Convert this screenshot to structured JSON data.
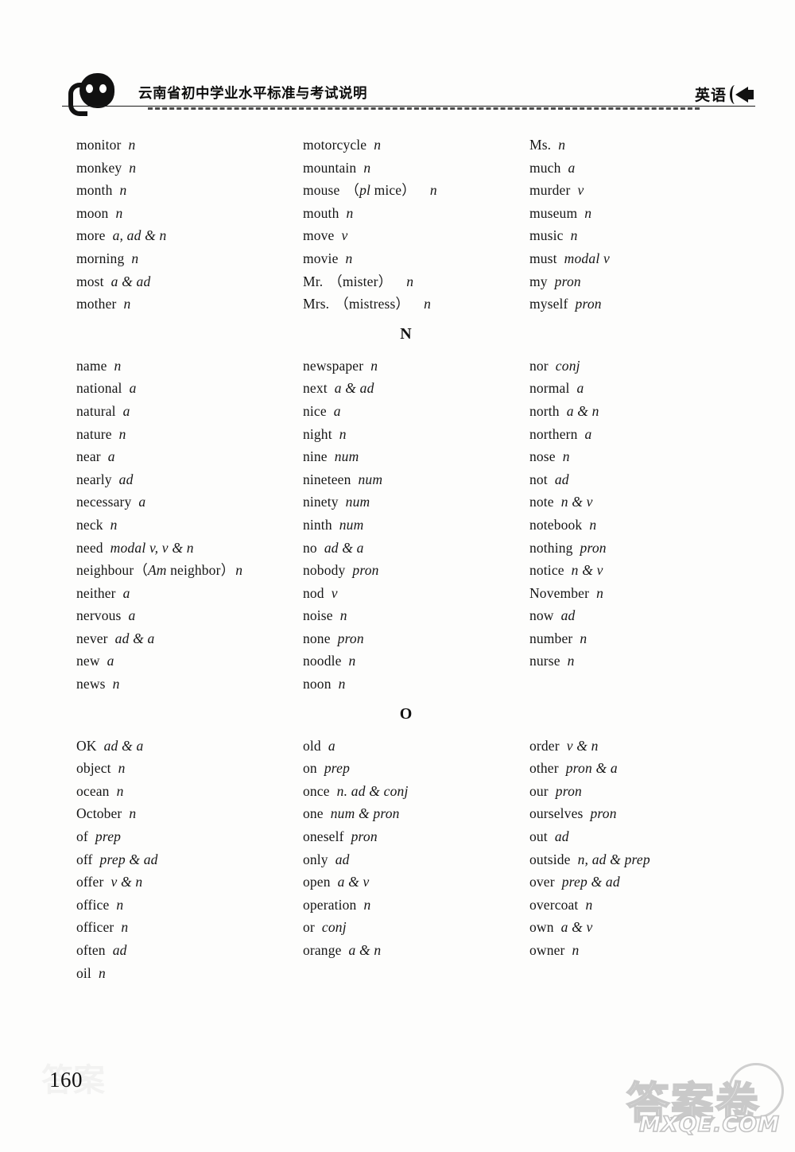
{
  "header": {
    "book_title": "云南省初中学业水平标准与考试说明",
    "subject": "英语",
    "left_icon": "head-silhouette-icon",
    "right_icon": "speaker-icon"
  },
  "page_number": "160",
  "watermark": {
    "chinese": "答案卷",
    "domain": "MXQE.COM"
  },
  "sections": [
    {
      "letter": "",
      "columns": [
        [
          {
            "word": "monitor",
            "pos": "n"
          },
          {
            "word": "monkey",
            "pos": "n"
          },
          {
            "word": "month",
            "pos": "n"
          },
          {
            "word": "moon",
            "pos": "n"
          },
          {
            "word": "more",
            "pos": "a, ad & n"
          },
          {
            "word": "morning",
            "pos": "n"
          },
          {
            "word": "most",
            "pos": "a & ad"
          },
          {
            "word": "mother",
            "pos": "n"
          }
        ],
        [
          {
            "word": "motorcycle",
            "pos": "n"
          },
          {
            "word": "mountain",
            "pos": "n"
          },
          {
            "word": "mouse",
            "paren_italic": "pl",
            "paren_plain": "mice",
            "pos": "n"
          },
          {
            "word": "mouth",
            "pos": "n"
          },
          {
            "word": "move",
            "pos": "v"
          },
          {
            "word": "movie",
            "pos": "n"
          },
          {
            "word": "Mr.",
            "paren_plain": "mister",
            "pos": "n"
          },
          {
            "word": "Mrs.",
            "paren_plain": "mistress",
            "pos": "n"
          }
        ],
        [
          {
            "word": "Ms.",
            "pos": "n"
          },
          {
            "word": "much",
            "pos": "a"
          },
          {
            "word": "murder",
            "pos": "v"
          },
          {
            "word": "museum",
            "pos": "n"
          },
          {
            "word": "music",
            "pos": "n"
          },
          {
            "word": "must",
            "pos": "modal v"
          },
          {
            "word": "my",
            "pos": "pron"
          },
          {
            "word": "myself",
            "pos": "pron"
          }
        ]
      ]
    },
    {
      "letter": "N",
      "columns": [
        [
          {
            "word": "name",
            "pos": "n"
          },
          {
            "word": "national",
            "pos": "a"
          },
          {
            "word": "natural",
            "pos": "a"
          },
          {
            "word": "nature",
            "pos": "n"
          },
          {
            "word": "near",
            "pos": "a"
          },
          {
            "word": "nearly",
            "pos": "ad"
          },
          {
            "word": "necessary",
            "pos": "a"
          },
          {
            "word": "neck",
            "pos": "n"
          },
          {
            "word": "need",
            "pos": "modal v, v & n"
          },
          {
            "word": "neighbour",
            "paren_italic": "Am",
            "paren_plain": "neighbor",
            "pos": "n",
            "tight": true
          },
          {
            "word": "neither",
            "pos": "a"
          },
          {
            "word": "nervous",
            "pos": "a"
          },
          {
            "word": "never",
            "pos": "ad & a"
          },
          {
            "word": "new",
            "pos": "a"
          },
          {
            "word": "news",
            "pos": "n"
          }
        ],
        [
          {
            "word": "newspaper",
            "pos": "n"
          },
          {
            "word": "next",
            "pos": "a & ad"
          },
          {
            "word": "nice",
            "pos": "a"
          },
          {
            "word": "night",
            "pos": "n"
          },
          {
            "word": "nine",
            "pos": "num"
          },
          {
            "word": "nineteen",
            "pos": "num"
          },
          {
            "word": "ninety",
            "pos": "num"
          },
          {
            "word": "ninth",
            "pos": "num"
          },
          {
            "word": "no",
            "pos": "ad & a"
          },
          {
            "word": "nobody",
            "pos": "pron"
          },
          {
            "word": "nod",
            "pos": "v"
          },
          {
            "word": "noise",
            "pos": "n"
          },
          {
            "word": "none",
            "pos": "pron"
          },
          {
            "word": "noodle",
            "pos": "n"
          },
          {
            "word": "noon",
            "pos": "n"
          }
        ],
        [
          {
            "word": "nor",
            "pos": "conj"
          },
          {
            "word": "normal",
            "pos": "a"
          },
          {
            "word": "north",
            "pos": "a & n"
          },
          {
            "word": "northern",
            "pos": "a"
          },
          {
            "word": "nose",
            "pos": "n"
          },
          {
            "word": "not",
            "pos": "ad"
          },
          {
            "word": "note",
            "pos": "n & v"
          },
          {
            "word": "notebook",
            "pos": "n"
          },
          {
            "word": "nothing",
            "pos": "pron"
          },
          {
            "word": "notice",
            "pos": "n & v"
          },
          {
            "word": "November",
            "pos": "n"
          },
          {
            "word": "now",
            "pos": "ad"
          },
          {
            "word": "number",
            "pos": "n"
          },
          {
            "word": "nurse",
            "pos": "n"
          }
        ]
      ]
    },
    {
      "letter": "O",
      "columns": [
        [
          {
            "word": "OK",
            "pos": "ad & a"
          },
          {
            "word": "object",
            "pos": "n"
          },
          {
            "word": "ocean",
            "pos": "n"
          },
          {
            "word": "October",
            "pos": "n"
          },
          {
            "word": "of",
            "pos": "prep"
          },
          {
            "word": "off",
            "pos": "prep & ad"
          },
          {
            "word": "offer",
            "pos": "v & n"
          },
          {
            "word": "office",
            "pos": "n"
          },
          {
            "word": "officer",
            "pos": "n"
          },
          {
            "word": "often",
            "pos": "ad"
          },
          {
            "word": "oil",
            "pos": "n"
          }
        ],
        [
          {
            "word": "old",
            "pos": "a"
          },
          {
            "word": "on",
            "pos": "prep"
          },
          {
            "word": "once",
            "pos": "n. ad & conj"
          },
          {
            "word": "one",
            "pos": "num & pron"
          },
          {
            "word": "oneself",
            "pos": "pron"
          },
          {
            "word": "only",
            "pos": "ad"
          },
          {
            "word": "open",
            "pos": "a & v"
          },
          {
            "word": "operation",
            "pos": "n"
          },
          {
            "word": "or",
            "pos": "conj"
          },
          {
            "word": "orange",
            "pos": "a & n"
          }
        ],
        [
          {
            "word": "order",
            "pos": "v & n"
          },
          {
            "word": "other",
            "pos": "pron & a"
          },
          {
            "word": "our",
            "pos": "pron"
          },
          {
            "word": "ourselves",
            "pos": "pron"
          },
          {
            "word": "out",
            "pos": "ad"
          },
          {
            "word": "outside",
            "pos": "n, ad & prep"
          },
          {
            "word": "over",
            "pos": "prep & ad"
          },
          {
            "word": "overcoat",
            "pos": "n"
          },
          {
            "word": "own",
            "pos": "a & v"
          },
          {
            "word": "owner",
            "pos": "n"
          }
        ]
      ]
    }
  ]
}
